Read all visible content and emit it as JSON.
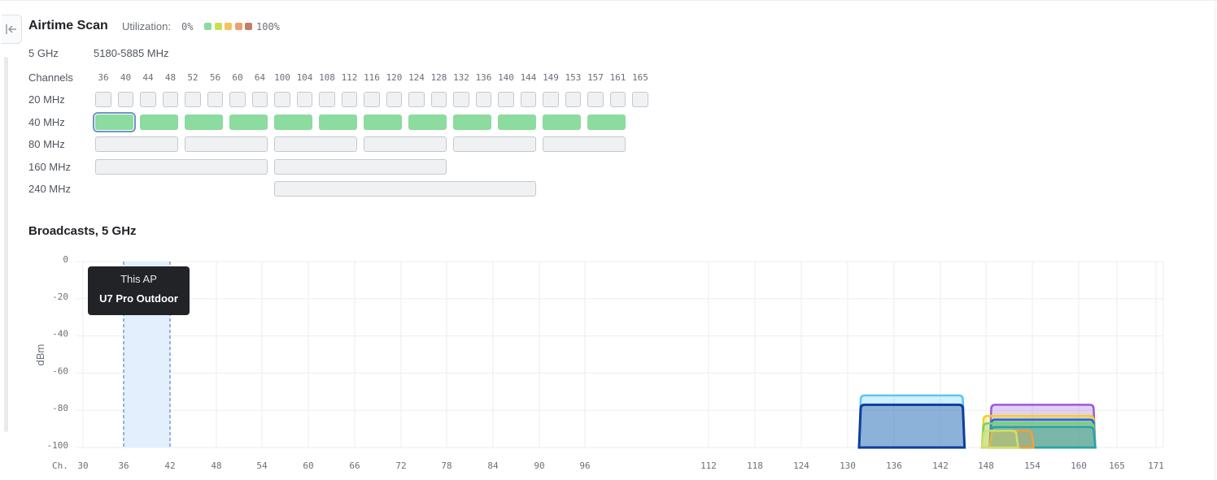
{
  "airtime": {
    "title": "Airtime Scan",
    "utilization_label": "Utilization:",
    "utilization_min": "0%",
    "utilization_max": "100%",
    "legend_colors": [
      "#8bdc9e",
      "#c8df52",
      "#f5c25e",
      "#ef9f6e",
      "#c47e66"
    ],
    "band_label": "5 GHz",
    "band_range": "5180-5885 MHz",
    "channels_label": "Channels",
    "channels": [
      "36",
      "40",
      "44",
      "48",
      "52",
      "56",
      "60",
      "64",
      "100",
      "104",
      "108",
      "112",
      "116",
      "120",
      "124",
      "128",
      "132",
      "136",
      "140",
      "144",
      "149",
      "153",
      "157",
      "161",
      "165"
    ],
    "rows": [
      {
        "label": "20 MHz"
      },
      {
        "label": "40 MHz"
      },
      {
        "label": "80 MHz"
      },
      {
        "label": "160 MHz"
      },
      {
        "label": "240 MHz"
      }
    ],
    "selected_width": "40 MHz",
    "selected_channel": "36",
    "forty_mhz_status": "green"
  },
  "broadcasts": {
    "title": "Broadcasts,  5 GHz",
    "tooltip": {
      "line1": "This AP",
      "line2": "U7 Pro Outdoor"
    }
  },
  "chart_data": {
    "type": "area",
    "ylabel": "dBm",
    "xlabel": "Ch.",
    "ylim": [
      -100,
      0
    ],
    "yticks": [
      "0",
      "-20",
      "-40",
      "-60",
      "-80",
      "-100"
    ],
    "xticks": [
      "30",
      "36",
      "42",
      "48",
      "54",
      "60",
      "66",
      "72",
      "78",
      "84",
      "90",
      "96",
      "112",
      "118",
      "124",
      "130",
      "136",
      "142",
      "148",
      "154",
      "160",
      "165",
      "171"
    ],
    "grid": true,
    "this_ap": {
      "channel_start": 36,
      "channel_end": 40
    },
    "series": [
      {
        "color": "#5bc8f0",
        "channel_start": 132,
        "channel_end": 144,
        "peak_dbm": -72
      },
      {
        "color": "#0d3e9e",
        "channel_start": 132,
        "channel_end": 144,
        "peak_dbm": -77
      },
      {
        "color": "#9b59d9",
        "channel_start": 149,
        "channel_end": 161,
        "peak_dbm": -77
      },
      {
        "color": "#f5d020",
        "channel_start": 148,
        "channel_end": 161,
        "peak_dbm": -83
      },
      {
        "color": "#1a6bd6",
        "channel_start": 149,
        "channel_end": 161,
        "peak_dbm": -85
      },
      {
        "color": "#6fd66a",
        "channel_start": 148,
        "channel_end": 161,
        "peak_dbm": -87
      },
      {
        "color": "#23a6a6",
        "channel_start": 149,
        "channel_end": 161,
        "peak_dbm": -89
      },
      {
        "color": "#f2a13a",
        "channel_start": 149,
        "channel_end": 153,
        "peak_dbm": -91
      },
      {
        "color": "#cfe06b",
        "channel_start": 148,
        "channel_end": 151,
        "peak_dbm": -91
      }
    ]
  }
}
